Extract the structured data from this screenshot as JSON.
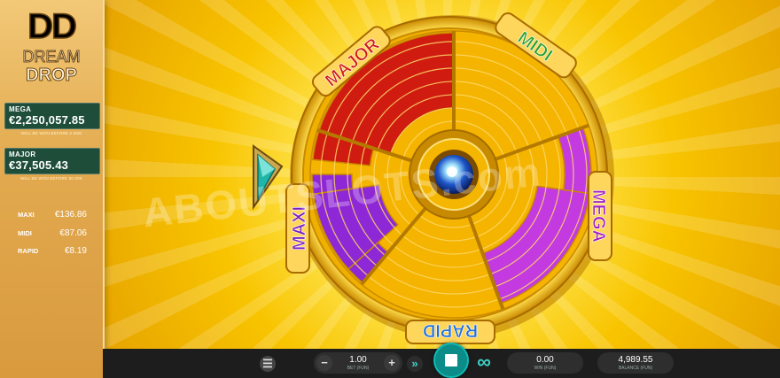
{
  "brand": {
    "logo_letters": "DD",
    "line1": "DREAM",
    "line2": "DROP"
  },
  "jackpots": {
    "mega": {
      "name": "MEGA",
      "value": "€2,250,057.85",
      "note": "WILL BE WON BEFORE 2.00M"
    },
    "major": {
      "name": "MAJOR",
      "value": "€37,505.43",
      "note": "WILL BE WON BEFORE 50.00K"
    },
    "minis": [
      {
        "name": "MAXI",
        "value": "€136.86"
      },
      {
        "name": "MIDI",
        "value": "€87.06"
      },
      {
        "name": "RAPID",
        "value": "€8.19"
      }
    ]
  },
  "wheel": {
    "labels": [
      "MAJOR",
      "MIDI",
      "MEGA",
      "RAPID",
      "MAXI"
    ],
    "colors": {
      "major": "#d01c10",
      "mega": "#c23ae0",
      "maxi": "#8e28d6",
      "gold": "#f5b400",
      "midi_text": "#2ca02c",
      "rapid_text": "#1e6fd9"
    }
  },
  "watermark": "ABOUTSLOTS.com",
  "bottom_bar": {
    "bet": {
      "value": "1.00",
      "label": "BET (FUN)"
    },
    "win": {
      "value": "0.00",
      "label": "WIN (FUN)"
    },
    "balance": {
      "value": "4,989.55",
      "label": "BALANCE (FUN)"
    },
    "icons": {
      "menu": "☰",
      "minus": "−",
      "plus": "+",
      "turbo": "»",
      "autoplay": "∞"
    }
  }
}
